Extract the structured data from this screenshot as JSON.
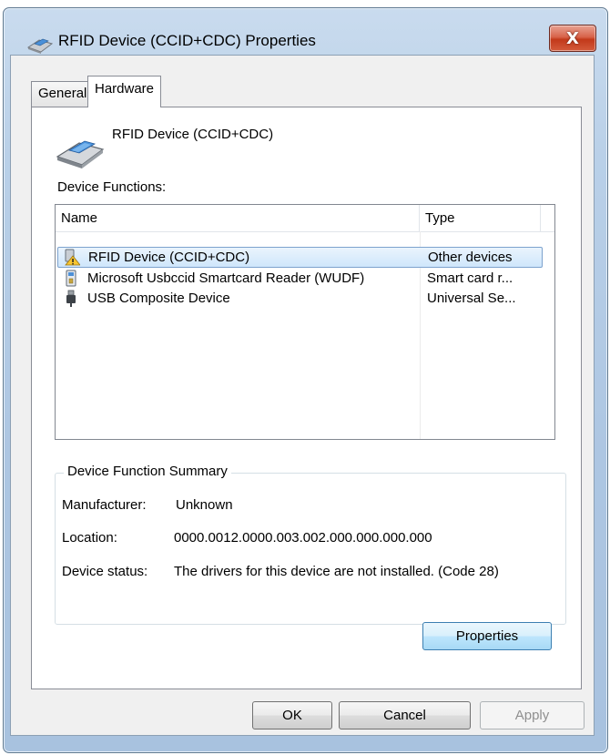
{
  "window": {
    "title": "RFID Device (CCID+CDC) Properties",
    "close_glyph": "X"
  },
  "tabs": [
    {
      "label": "General",
      "active": false
    },
    {
      "label": "Hardware",
      "active": true
    }
  ],
  "device": {
    "name": "RFID Device (CCID+CDC)",
    "icon": "smartcard-reader-icon"
  },
  "functions": {
    "label": "Device Functions:",
    "columns": [
      "Name",
      "Type"
    ],
    "rows": [
      {
        "name": "RFID Device (CCID+CDC)",
        "type": "Other devices",
        "icon": "warning-device-icon",
        "selected": true
      },
      {
        "name": "Microsoft Usbccid Smartcard Reader (WUDF)",
        "type": "Smart card r...",
        "icon": "smartcard-icon",
        "selected": false
      },
      {
        "name": "USB Composite Device",
        "type": "Universal Se...",
        "icon": "usb-plug-icon",
        "selected": false
      }
    ]
  },
  "summary": {
    "title": "Device Function Summary",
    "manufacturer_label": "Manufacturer:",
    "manufacturer_value": "Unknown",
    "location_label": "Location:",
    "location_value": "0000.0012.0000.003.002.000.000.000.000",
    "status_label": "Device status:",
    "status_value": "The drivers for this device are not installed. (Code 28)",
    "properties_button": "Properties"
  },
  "buttons": {
    "ok": "OK",
    "cancel": "Cancel",
    "apply": "Apply"
  },
  "colors": {
    "selection": "#cfe6fb",
    "frame": "#b9d0e8",
    "close": "#c2391a"
  }
}
